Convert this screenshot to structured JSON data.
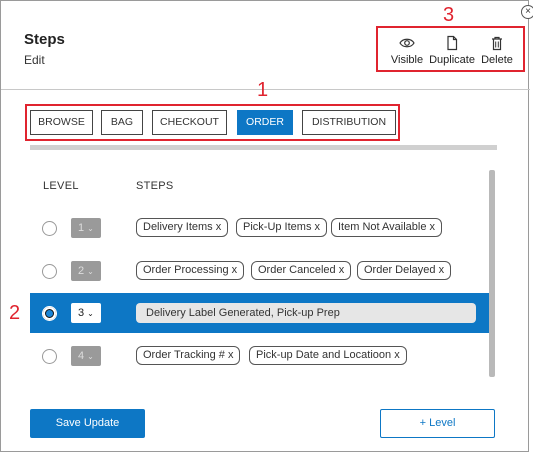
{
  "header": {
    "title": "Steps",
    "subtitle": "Edit"
  },
  "actions": {
    "visible": "Visible",
    "duplicate": "Duplicate",
    "delete": "Delete"
  },
  "callouts": {
    "tabs": "1",
    "selected_row": "2",
    "actions": "3"
  },
  "colors": {
    "accent": "#0d77c5",
    "callout": "#e0242f"
  },
  "tabs": [
    {
      "label": "BROWSE",
      "active": false
    },
    {
      "label": "BAG",
      "active": false
    },
    {
      "label": "CHECKOUT",
      "active": false
    },
    {
      "label": "ORDER",
      "active": true
    },
    {
      "label": "DISTRIBUTION",
      "active": false
    }
  ],
  "columns": {
    "level": "LEVEL",
    "steps": "STEPS"
  },
  "rows": [
    {
      "level": "1",
      "chips": [
        "Delivery Items x",
        "Pick-Up Items x",
        "Item Not Available x"
      ]
    },
    {
      "level": "2",
      "chips": [
        "Order Processing x",
        "Order Canceled x",
        "Order Delayed x"
      ]
    },
    {
      "level": "3",
      "selected": true,
      "input_value": "Delivery Label Generated, Pick-up Prep"
    },
    {
      "level": "4",
      "chips": [
        "Order Tracking # x",
        "Pick-up Date and Locatioon x"
      ]
    }
  ],
  "footer": {
    "save": "Save Update",
    "add_level": "+ Level"
  },
  "icons": {
    "close": "close-icon",
    "visible": "eye-icon",
    "duplicate": "document-icon",
    "delete": "trash-icon",
    "dropdown": "chevron-down-icon"
  }
}
